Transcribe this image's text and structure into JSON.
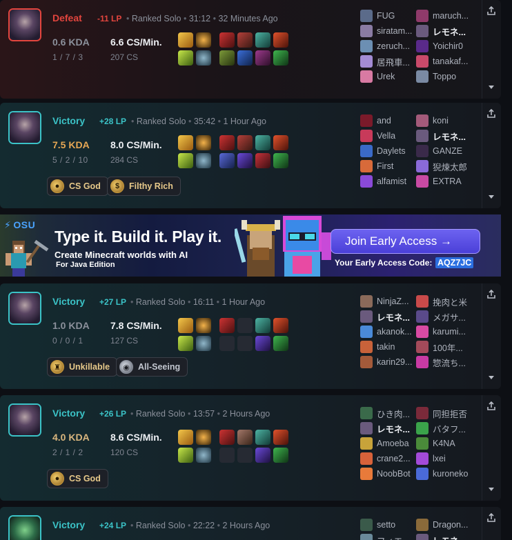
{
  "matches": [
    {
      "result": "Defeat",
      "lp": "-11 LP",
      "queue": "Ranked Solo",
      "duration": "31:12",
      "ago": "32 Minutes Ago",
      "kda_ratio": "0.6 KDA",
      "kda": "1 / 7 / 3",
      "cs_per_min": "6.6 CS/Min.",
      "cs": "207 CS",
      "badges": [],
      "team_left": [
        "FUG",
        "siratam...",
        "zeruch...",
        "居飛車...",
        "Urek"
      ],
      "team_right": [
        "maruch...",
        "レモネ...",
        "Yoichir0",
        "tanakaf...",
        "Toppo"
      ],
      "me_right_index": 1
    },
    {
      "result": "Victory",
      "lp": "+28 LP",
      "queue": "Ranked Solo",
      "duration": "35:42",
      "ago": "1 Hour Ago",
      "kda_ratio": "7.5 KDA",
      "kda": "5 / 2 / 10",
      "cs_per_min": "8.0 CS/Min.",
      "cs": "284 CS",
      "badges": [
        "CS God",
        "Filthy Rich"
      ],
      "team_left": [
        "and",
        "Vella",
        "Daylets",
        "First",
        "alfamist"
      ],
      "team_right": [
        "koni",
        "レモネ...",
        "GANZE",
        "猊煉太郎",
        "EXTRA"
      ],
      "me_right_index": 1
    },
    {
      "result": "Victory",
      "lp": "+27 LP",
      "queue": "Ranked Solo",
      "duration": "16:11",
      "ago": "1 Hour Ago",
      "kda_ratio": "1.0 KDA",
      "kda": "0 / 0 / 1",
      "cs_per_min": "7.8 CS/Min.",
      "cs": "127 CS",
      "badges": [
        "Unkillable",
        "All-Seeing"
      ],
      "team_left": [
        "NinjaZ...",
        "レモネ...",
        "akanok...",
        "takin",
        "karin29..."
      ],
      "team_right": [
        "挽肉と米",
        "メガサ...",
        "karumi...",
        "100年...",
        "惣流ち..."
      ],
      "me_left_index": 1
    },
    {
      "result": "Victory",
      "lp": "+26 LP",
      "queue": "Ranked Solo",
      "duration": "13:57",
      "ago": "2 Hours Ago",
      "kda_ratio": "4.0 KDA",
      "kda": "2 / 1 / 2",
      "cs_per_min": "8.6 CS/Min.",
      "cs": "120 CS",
      "badges": [
        "CS God"
      ],
      "team_left": [
        "ひき肉...",
        "レモネ...",
        "Amoeba",
        "crane2...",
        "NoobBot"
      ],
      "team_right": [
        "同担拒否",
        "バタフ...",
        "K4NA",
        "lxei",
        "kuroneko"
      ],
      "me_left_index": 1
    },
    {
      "result": "Victory",
      "lp": "+24 LP",
      "queue": "Ranked Solo",
      "duration": "22:22",
      "ago": "2 Hours Ago",
      "team_left": [
        "setto",
        "フィエ..."
      ],
      "team_right": [
        "Dragon...",
        "レモネ..."
      ]
    }
  ],
  "ad": {
    "brand": "OSU",
    "title": "Type it. Build it. Play it.",
    "subtitle": "Create Minecraft worlds with AI",
    "subtitle2": "For Java Edition",
    "cta": "Join Early Access →",
    "code_label": "Your Early Access Code:",
    "code": "AQZ7JC"
  },
  "colors": {
    "defeat": "#e3453e",
    "victory": "#3bc3c7",
    "gold_badge": "#e7c98a"
  },
  "icons": {
    "share": "share-icon",
    "expand": "chevron-down-icon",
    "badge_cs_god": "coin-icon",
    "badge_filthy_rich": "money-bag-icon",
    "badge_unkillable": "shield-icon",
    "badge_all_seeing": "eye-icon"
  }
}
